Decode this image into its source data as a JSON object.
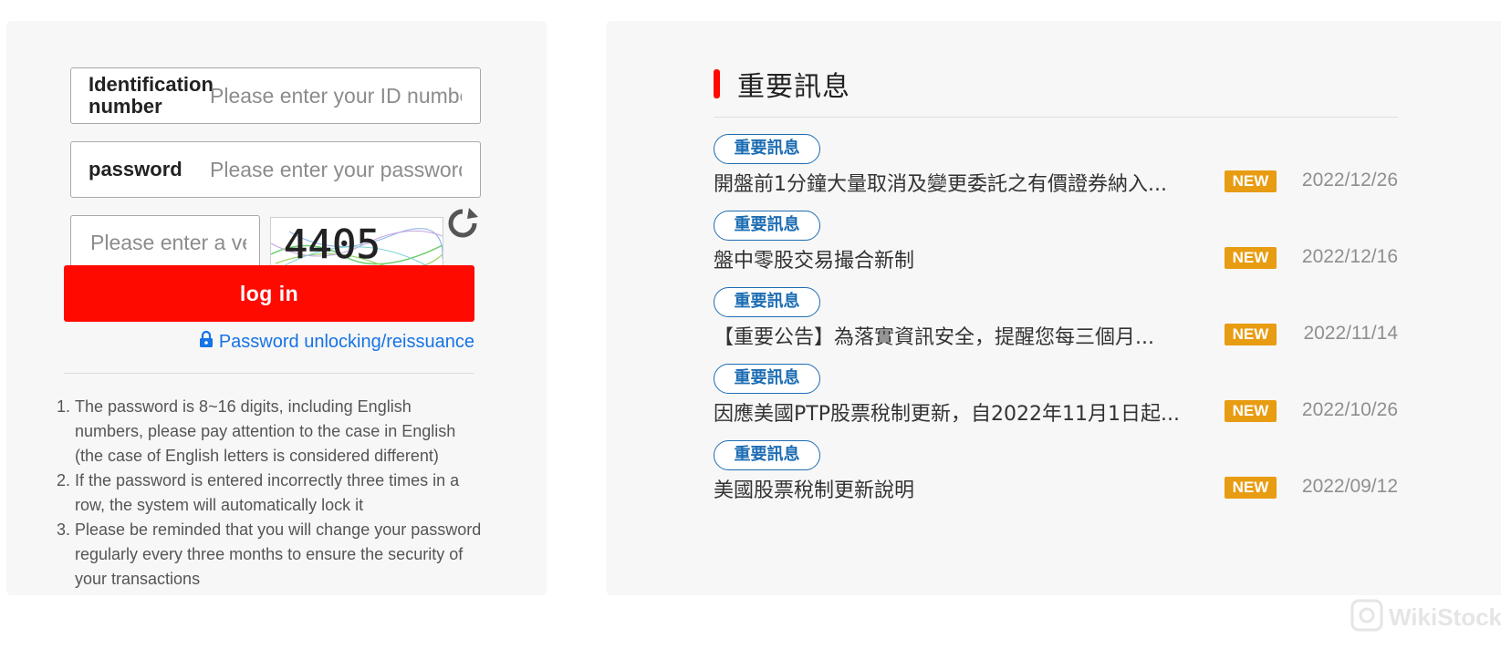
{
  "login": {
    "id_label": "Identification number",
    "id_placeholder": "Please enter your ID number",
    "password_label": "password",
    "password_placeholder": "Please enter your password",
    "captcha_placeholder": "Please enter a verification code",
    "captcha_text": "4405",
    "login_label": "log in",
    "unlock_label": "Password unlocking/reissuance",
    "notes": [
      "The password is 8~16 digits, including English numbers, please pay attention to the case in English (the case of English letters is considered different)",
      "If the password is entered incorrectly three times in a row, the system will automatically lock it",
      "Please be reminded that you will change your password regularly every three months to ensure the security of your transactions"
    ],
    "icons": {
      "refresh": "refresh-icon",
      "lock": "lock-icon"
    },
    "colors": {
      "login_button": "#ff0a00",
      "link": "#1673e6"
    }
  },
  "news": {
    "title": "重要訊息",
    "items": [
      {
        "tag": "重要訊息",
        "title": "開盤前1分鐘大量取消及變更委託之有價證券納入...",
        "badge": "NEW",
        "date": "2022/12/26"
      },
      {
        "tag": "重要訊息",
        "title": "盤中零股交易撮合新制",
        "badge": "NEW",
        "date": "2022/12/16"
      },
      {
        "tag": "重要訊息",
        "title": "【重要公告】為落實資訊安全，提醒您每三個月...",
        "badge": "NEW",
        "date": "2022/11/14"
      },
      {
        "tag": "重要訊息",
        "title": "因應美國PTP股票稅制更新，自2022年11月1日起...",
        "badge": "NEW",
        "date": "2022/10/26"
      },
      {
        "tag": "重要訊息",
        "title": "美國股票稅制更新說明",
        "badge": "NEW",
        "date": "2022/09/12"
      }
    ],
    "colors": {
      "accent_bar": "#ff0a00",
      "tag": "#1d6db3",
      "badge": "#e89c12"
    }
  },
  "watermark": {
    "text": "WikiStock"
  }
}
